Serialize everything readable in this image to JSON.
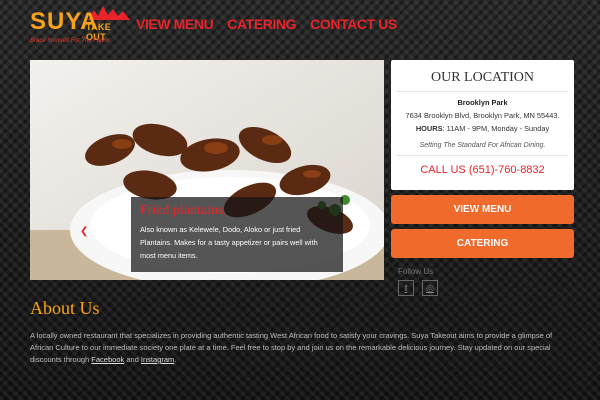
{
  "logo": {
    "name": "SUYA",
    "sub": "TAKE OUT",
    "tagline": "Brace Yourself For The Flavor"
  },
  "nav": {
    "view_menu": "VIEW MENU",
    "catering": "CATERING",
    "contact_us": "CONTACT US"
  },
  "hero": {
    "caption_title": "Fried plantains",
    "caption_text": "Also known as Kelewele, Dodo, Aloko or just fried Plantains. Makes for a tasty appetizer or pairs well with most menu items."
  },
  "location": {
    "title": "OUR LOCATION",
    "name": "Brooklyn Park",
    "address": "7634 Brooklyn Blvd, Brooklyn Park, MN 55443.",
    "hours_label": "HOURS",
    "hours": ": 11AM - 9PM, Monday - Sunday",
    "slogan": "Setting The Standard For African Dining.",
    "call": "CALL US (651)-760-8832"
  },
  "buttons": {
    "view_menu": "VIEW MENU",
    "catering": "CATERING"
  },
  "social": {
    "follow": "Follow Us",
    "facebook_glyph": "f",
    "instagram_glyph": "◎"
  },
  "about": {
    "title": "About Us",
    "text_pre": "A locally owned restaurant that specializes in providing authentic tasting West African food to satisfy your cravings. Suya Takeout aims to provide a glimpse of African Culture to our immediate society one plate at a time. Feel free to stop by and join us on the remarkable delicious journey. Stay updated on our special discounts through ",
    "facebook": "Facebook",
    "and": " and ",
    "instagram": "Instagram",
    "end": "."
  },
  "colors": {
    "accent_red": "#e8242a",
    "accent_orange": "#ef6a2b",
    "logo_gold": "#f7a21b"
  }
}
